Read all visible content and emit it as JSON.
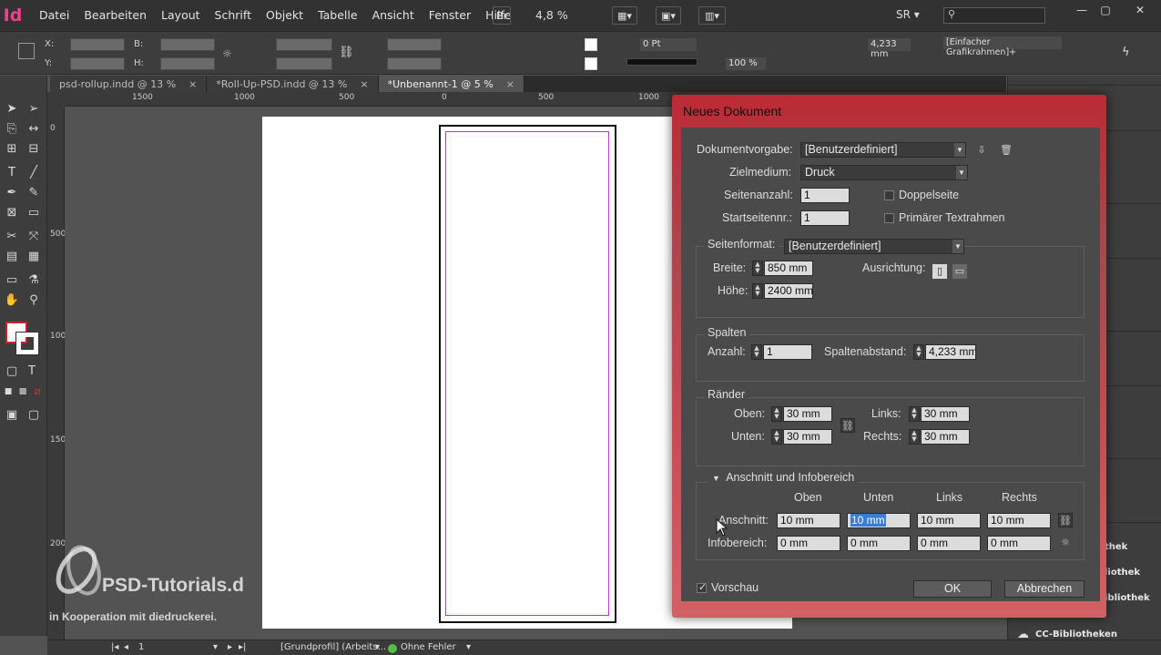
{
  "app": {
    "logo": "Id",
    "menu": [
      "Datei",
      "Bearbeiten",
      "Layout",
      "Schrift",
      "Objekt",
      "Tabelle",
      "Ansicht",
      "Fenster",
      "Hilfe"
    ],
    "bridge_label": "Br",
    "zoom": "4,8 %",
    "workspace": "SR"
  },
  "control_panel": {
    "x_label": "X:",
    "y_label": "Y:",
    "w_label": "B:",
    "h_label": "H:",
    "stroke_weight": "0 Pt",
    "stroke_offset": "4,233 mm",
    "opacity": "100 %",
    "frame_style": "[Einfacher Grafikrahmen]+"
  },
  "tabs": [
    {
      "label": "psd-rollup.indd @ 13 %",
      "close": "×"
    },
    {
      "label": "*Roll-Up-PSD.indd @ 13 %",
      "close": "×"
    },
    {
      "label": "*Unbenannt-1 @ 5 %",
      "close": "×"
    }
  ],
  "ruler": {
    "h_ticks": [
      "1500",
      "1000",
      "500",
      "0",
      "500",
      "1000",
      "1500"
    ],
    "v_ticks": [
      "0",
      "500",
      "1000",
      "1500",
      "2000"
    ]
  },
  "watermark": {
    "title": "PSD-Tutorials.d",
    "sub": "in Kooperation mit  diedruckerei."
  },
  "right_panel": {
    "partial_labels": [
      "thek",
      "liothek",
      "ibliothek"
    ],
    "cc_libraries": "CC-Bibliotheken"
  },
  "status_bar": {
    "page": "1",
    "profile": "[Grundprofil] (Arbeits...",
    "errors": "Ohne Fehler"
  },
  "dialog": {
    "title": "Neues Dokument",
    "preset_label": "Dokumentvorgabe:",
    "preset_value": "[Benutzerdefiniert]",
    "intent_label": "Zielmedium:",
    "intent_value": "Druck",
    "pages_label": "Seitenanzahl:",
    "pages_value": "1",
    "facing_label": "Doppelseite",
    "facing_checked": false,
    "start_label": "Startseitennr.:",
    "start_value": "1",
    "primary_frame_label": "Primärer Textrahmen",
    "primary_frame_checked": false,
    "page_size": {
      "label": "Seitenformat:",
      "value": "[Benutzerdefiniert]",
      "width_label": "Breite:",
      "width_value": "850 mm",
      "height_label": "Höhe:",
      "height_value": "2400 mm",
      "orientation_label": "Ausrichtung:"
    },
    "columns": {
      "title": "Spalten",
      "number_label": "Anzahl:",
      "number_value": "1",
      "gutter_label": "Spaltenabstand:",
      "gutter_value": "4,233 mm"
    },
    "margins": {
      "title": "Ränder",
      "top_label": "Oben:",
      "top_value": "30 mm",
      "bottom_label": "Unten:",
      "bottom_value": "30 mm",
      "left_label": "Links:",
      "left_value": "30 mm",
      "right_label": "Rechts:",
      "right_value": "30 mm"
    },
    "bleed": {
      "title": "Anschnitt und Infobereich",
      "col_top": "Oben",
      "col_bottom": "Unten",
      "col_left": "Links",
      "col_right": "Rechts",
      "bleed_label": "Anschnitt:",
      "bleed_top": "10 mm",
      "bleed_bottom": "10 mm",
      "bleed_left": "10 mm",
      "bleed_right": "10 mm",
      "slug_label": "Infobereich:",
      "slug_top": "0 mm",
      "slug_bottom": "0 mm",
      "slug_left": "0 mm",
      "slug_right": "0 mm"
    },
    "preview_label": "Vorschau",
    "preview_checked": true,
    "ok_label": "OK",
    "cancel_label": "Abbrechen"
  }
}
